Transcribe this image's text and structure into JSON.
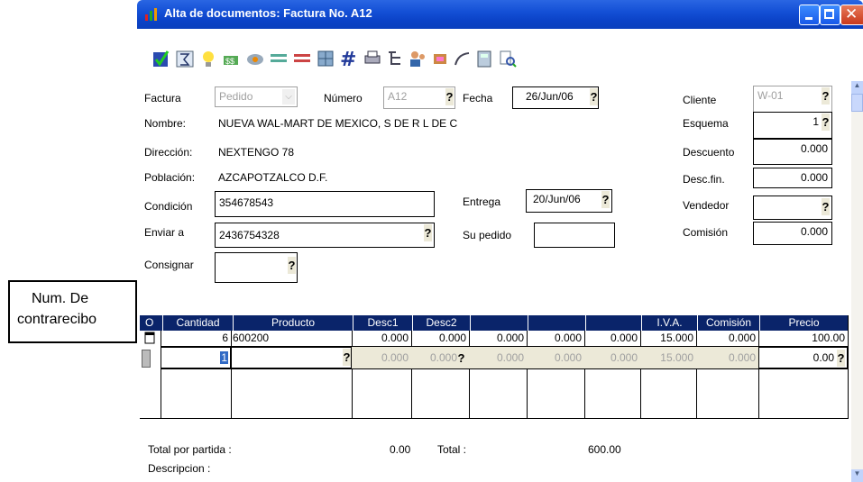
{
  "window": {
    "title": "Alta de documentos: Factura No. A12"
  },
  "toolbar": {
    "icons": [
      "check-icon",
      "sum-icon",
      "bulb-icon",
      "money-icon",
      "link-icon",
      "lines-icon",
      "lines-icon",
      "grid-icon",
      "hash-icon",
      "print-icon",
      "tree-icon",
      "users-icon",
      "truck-icon",
      "curve-icon",
      "calc-icon",
      "search-icon"
    ]
  },
  "form": {
    "factura_label": "Factura",
    "factura_value": "Pedido",
    "numero_label": "Número",
    "numero_value": "A12",
    "fecha_label": "Fecha",
    "fecha_value": "26/Jun/06",
    "cliente_label": "Cliente",
    "cliente_value": "W-01",
    "nombre_label": "Nombre:",
    "nombre_value": "NUEVA WAL-MART DE MEXICO, S DE R L DE C",
    "esquema_label": "Esquema",
    "esquema_value": "1",
    "direccion_label": "Dirección:",
    "direccion_value": "NEXTENGO 78",
    "descuento_label": "Descuento",
    "descuento_value": "0.000",
    "poblacion_label": "Población:",
    "poblacion_value": "AZCAPOTZALCO  D.F.",
    "descfin_label": "Desc.fin.",
    "descfin_value": "0.000",
    "condicion_label": "Condición",
    "condicion_value": "354678543",
    "entrega_label": "Entrega",
    "entrega_value": "20/Jun/06",
    "vendedor_label": "Vendedor",
    "vendedor_value": "",
    "enviar_label": "Enviar a",
    "enviar_value": "2436754328",
    "supedido_label": "Su pedido",
    "supedido_value": "",
    "comision_label": "Comisión",
    "comision_value": "0.000",
    "consignar_label": "Consignar",
    "consignar_value": "",
    "q": "?"
  },
  "grid": {
    "headers": [
      "O",
      "Cantidad",
      "Producto",
      "Desc1",
      "Desc2",
      "",
      "",
      "",
      "I.V.A.",
      "Comisión",
      "Precio"
    ],
    "row1": [
      "6",
      "600200",
      "0.000",
      "0.000",
      "0.000",
      "0.000",
      "0.000",
      "15.000",
      "0.000",
      "100.00"
    ],
    "row2": [
      "1",
      "",
      "0.000",
      "0.000",
      "0.000",
      "0.000",
      "0.000",
      "15.000",
      "0.000",
      "0.00"
    ]
  },
  "footer": {
    "total_partida_label": "Total por partida :",
    "total_partida_value": "0.00",
    "total_label": "Total  :",
    "total_value": "600.00",
    "descripcion_label": "Descripcion :"
  },
  "callout": {
    "line1": "Num.  De",
    "line2": "contrarecibo"
  },
  "colors": {
    "title_bar": "#0b43c8",
    "grid_header": "#0a246a"
  }
}
